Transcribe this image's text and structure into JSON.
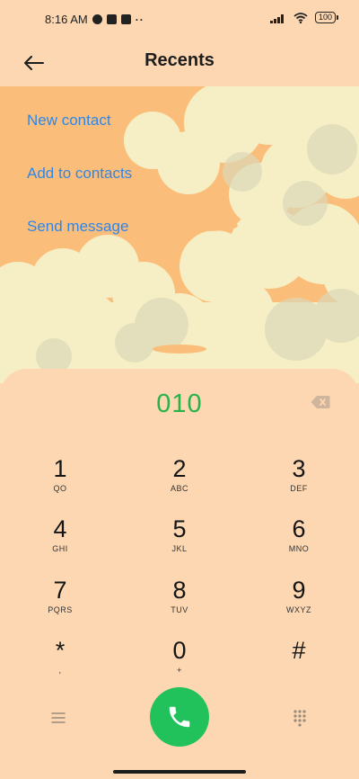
{
  "status_bar": {
    "time": "8:16 AM",
    "battery": "100",
    "icons": [
      "notification-icon",
      "app-icon",
      "upload-icon",
      "signal-icon",
      "wifi-icon",
      "battery-icon"
    ]
  },
  "header": {
    "title": "Recents",
    "back_icon": "arrow-left-icon"
  },
  "actions": {
    "new_contact": "New contact",
    "add_to_contacts": "Add to contacts",
    "send_message": "Send message"
  },
  "dialer": {
    "number": "010",
    "keys": [
      {
        "digit": "1",
        "letters": "QO"
      },
      {
        "digit": "2",
        "letters": "ABC"
      },
      {
        "digit": "3",
        "letters": "DEF"
      },
      {
        "digit": "4",
        "letters": "GHI"
      },
      {
        "digit": "5",
        "letters": "JKL"
      },
      {
        "digit": "6",
        "letters": "MNO"
      },
      {
        "digit": "7",
        "letters": "PQRS"
      },
      {
        "digit": "8",
        "letters": "TUV"
      },
      {
        "digit": "9",
        "letters": "WXYZ"
      },
      {
        "digit": "*",
        "letters": ","
      },
      {
        "digit": "0",
        "letters": "+"
      },
      {
        "digit": "#",
        "letters": ""
      }
    ]
  },
  "colors": {
    "background": "#fcd7b2",
    "link": "#2f86e6",
    "number": "#27b34a",
    "call_button": "#21c25b"
  }
}
